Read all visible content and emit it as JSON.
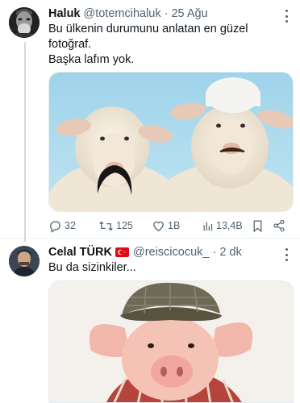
{
  "tweets": [
    {
      "author_name": "Haluk",
      "handle": "@totemcihaluk",
      "time": "25 Ağu",
      "text_lines": [
        "Bu ülkenin durumunu anlatan en güzel",
        "fotoğraf.",
        "Başka lafım yok."
      ],
      "media_icon": "photo-two-sheep",
      "stats": {
        "replies": "32",
        "retweets": "125",
        "likes": "1B",
        "views": "13,4B"
      }
    },
    {
      "author_name": "Celal TÜRK",
      "flag_icon": "turkey-flag-icon",
      "handle": "@reiscicocuk_",
      "time": "2 dk",
      "text_lines": [
        "Bu da sizinkiler..."
      ],
      "media_icon": "photo-pig-with-cap"
    }
  ],
  "separator": "·",
  "colors": {
    "text": "#0f1419",
    "secondary": "#536471",
    "divider": "#eff3f4",
    "flag": "#e30a17"
  }
}
